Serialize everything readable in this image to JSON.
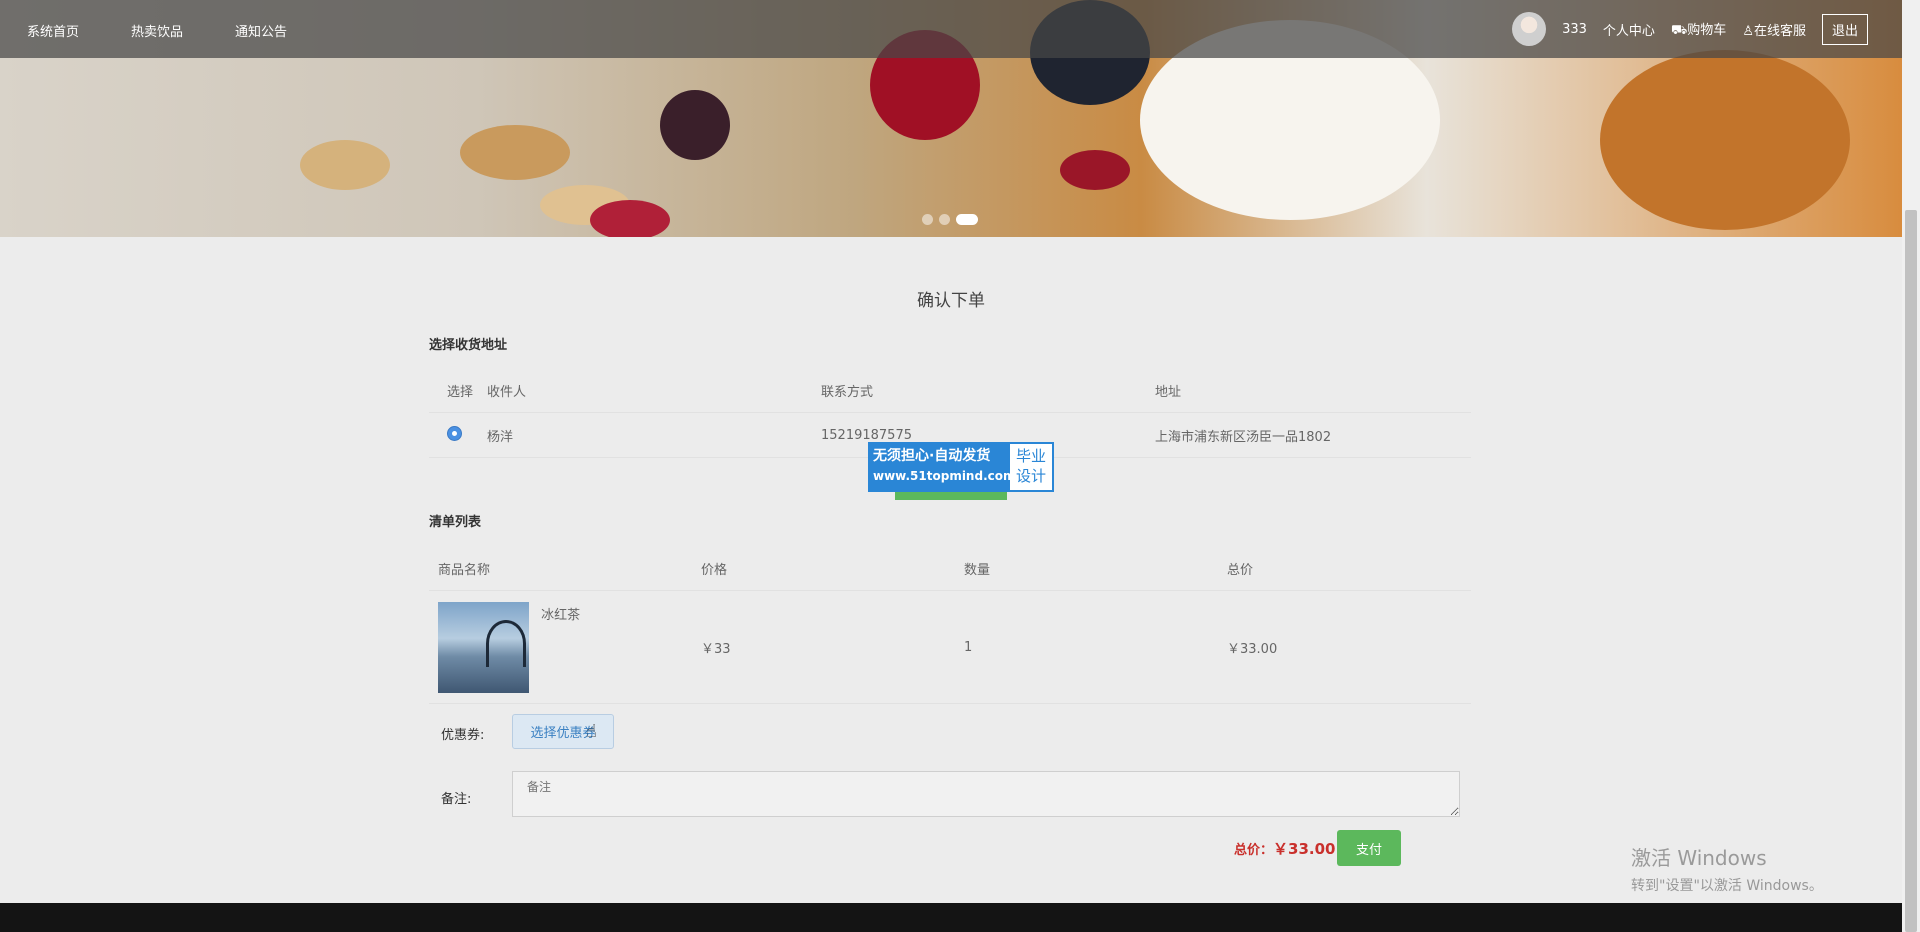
{
  "nav": {
    "items": [
      {
        "label": "系统首页"
      },
      {
        "label": "热卖饮品"
      },
      {
        "label": "通知公告"
      }
    ],
    "user": {
      "name": "333"
    },
    "profile_label": "个人中心",
    "cart_label": "购物车",
    "service_label": "在线客服",
    "logout_label": "退出"
  },
  "page": {
    "title": "确认下单"
  },
  "address": {
    "section_title": "选择收货地址",
    "headers": [
      "选择",
      "收件人",
      "联系方式",
      "地址"
    ],
    "rows": [
      {
        "name": "杨洋",
        "phone": "15219187575",
        "address": "上海市浦东新区汤臣一品1802",
        "selected": true
      }
    ]
  },
  "watermark": {
    "line1": "无须担心·自动发货",
    "line2": "www.51topmind.com",
    "right1": "毕业",
    "right2": "设计"
  },
  "items": {
    "section_title": "清单列表",
    "headers": [
      "商品名称",
      "价格",
      "数量",
      "总价"
    ],
    "rows": [
      {
        "name": "冰红茶",
        "price": "￥33",
        "quantity": "1",
        "total": "￥33.00"
      }
    ]
  },
  "coupon": {
    "label": "优惠券:",
    "button_label": "选择优惠券"
  },
  "remark": {
    "label": "备注:",
    "placeholder": "备注"
  },
  "summary": {
    "total_label": "总价：",
    "total_value": "￥33.00",
    "pay_label": "支付"
  },
  "windows": {
    "line1": "激活 Windows",
    "line2": "转到\"设置\"以激活 Windows。"
  }
}
